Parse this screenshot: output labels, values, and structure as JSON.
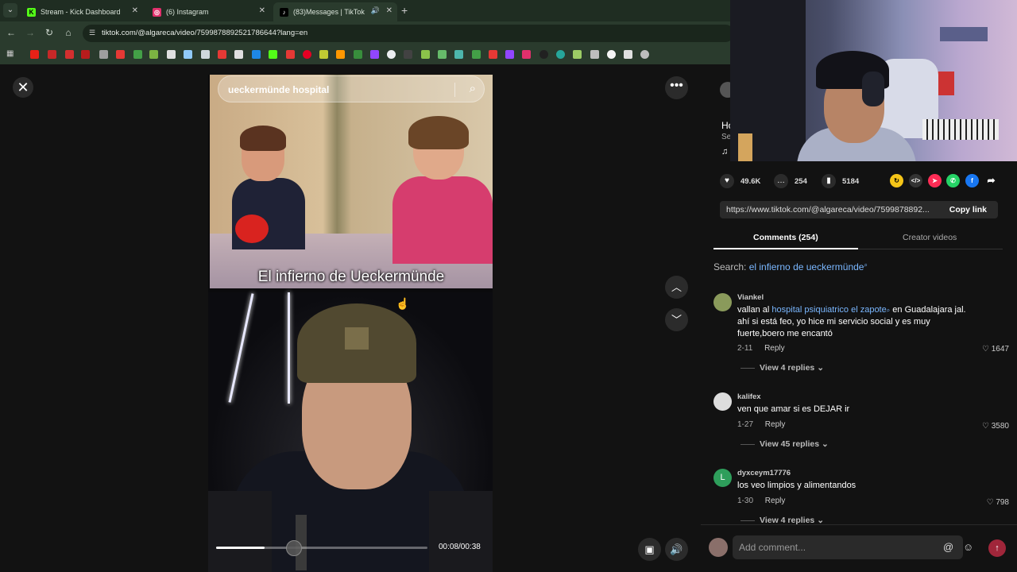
{
  "browser": {
    "tabs": [
      {
        "title": "Stream - Kick Dashboard",
        "favicon": "K",
        "color": "#53fc18"
      },
      {
        "title": "(6) Instagram",
        "favicon": "◎",
        "color": "#e1306c"
      },
      {
        "title": "(83)Messages | TikTok",
        "favicon": "♪",
        "color": "#000000"
      }
    ],
    "url": "tiktok.com/@algareca/video/7599878892521786644?lang=en"
  },
  "video": {
    "search_text": "ueckermünde hospital",
    "caption": "El infierno de Ueckermünde",
    "progress": 0.37,
    "played": 0.23,
    "time": "00:08/00:38"
  },
  "sidebar": {
    "title_partial": "Ho",
    "subtitle_partial": "Se",
    "music_icon": "♫"
  },
  "actions": {
    "likes": "49.6K",
    "comments": "254",
    "saves": "5184"
  },
  "link": {
    "url": "https://www.tiktok.com/@algareca/video/7599878892...",
    "copy_label": "Copy link"
  },
  "tabs": {
    "comments": "Comments (254)",
    "creator": "Creator videos"
  },
  "search_hint": {
    "prefix": "Search:",
    "query": "el infierno de ueckermünde"
  },
  "comments": [
    {
      "user": "Viankel",
      "text_pre": "vallan al ",
      "link": "hospital psiquiatrico el zapote",
      "text_post": " en Guadalajara jal. ahí si está feo, yo hice mi servicio social y es muy fuerte,boero me encantó",
      "date": "2-11",
      "reply": "Reply",
      "likes": "1647",
      "replies": "View 4 replies"
    },
    {
      "user": "kalifex",
      "text_pre": "ven que amar si es DEJAR ir",
      "link": "",
      "text_post": "",
      "date": "1-27",
      "reply": "Reply",
      "likes": "3580",
      "replies": "View 45 replies"
    },
    {
      "user": "dyxceym17776",
      "text_pre": "los veo limpios y alimentandos",
      "link": "",
      "text_post": "",
      "date": "1-30",
      "reply": "Reply",
      "likes": "798",
      "replies": "View 4 replies"
    }
  ],
  "add_comment": {
    "placeholder": "Add comment..."
  }
}
